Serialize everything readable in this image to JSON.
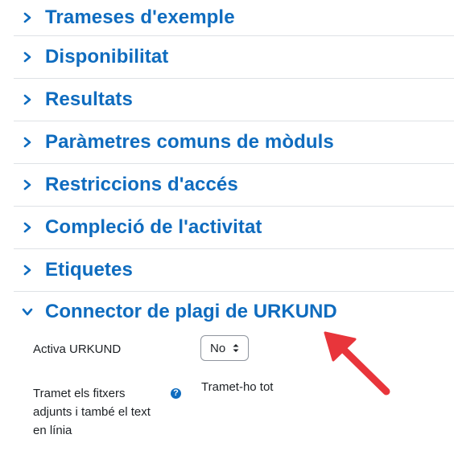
{
  "sections": [
    {
      "label": "Trameses d'exemple"
    },
    {
      "label": "Disponibilitat"
    },
    {
      "label": "Resultats"
    },
    {
      "label": "Paràmetres comuns de mòduls"
    },
    {
      "label": "Restriccions d'accés"
    },
    {
      "label": "Compleció de l'activitat"
    },
    {
      "label": "Etiquetes"
    }
  ],
  "expanded_section": {
    "label": "Connector de plagi de URKUND",
    "activate": {
      "label": "Activa URKUND",
      "value": "No"
    },
    "submit": {
      "label_lines": [
        "Tramet els fitxers",
        "adjunts i també el text",
        "en línia"
      ],
      "value": "Tramet-ho tot"
    }
  },
  "colors": {
    "accent": "#0f6cbf",
    "annotation_arrow": "#e8353b"
  }
}
